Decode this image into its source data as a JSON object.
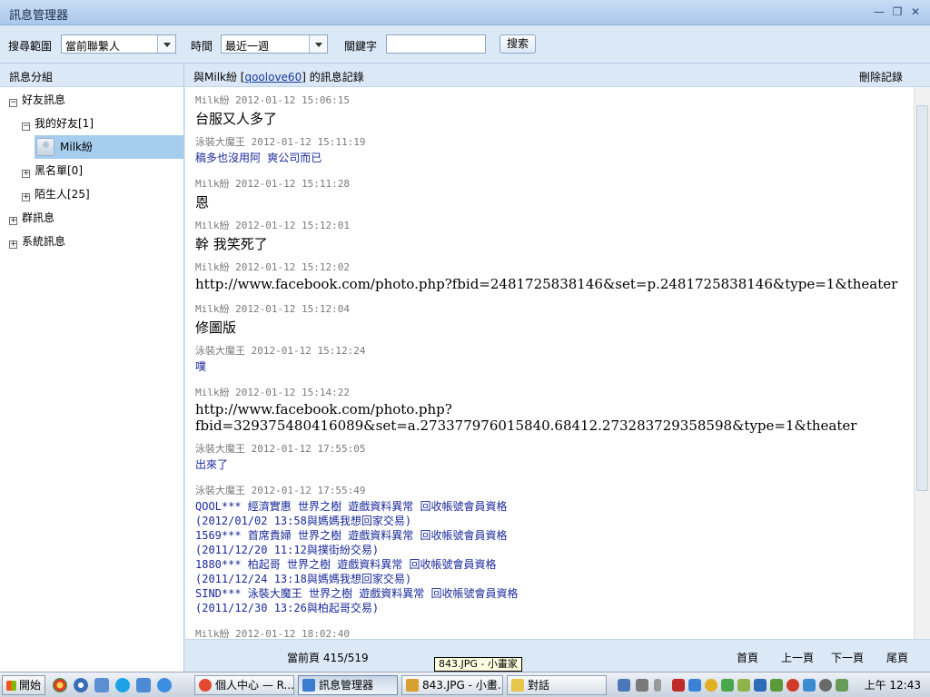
{
  "window": {
    "title": "訊息管理器",
    "minimize": "—",
    "restore": "❐",
    "close": "✕"
  },
  "search": {
    "scope_label": "搜尋範圍",
    "scope_value": "當前聯繫人",
    "time_label": "時間",
    "time_value": "最近一週",
    "keyword_label": "關鍵字",
    "keyword_value": "",
    "search_button": "搜索"
  },
  "sidebar": {
    "header": "訊息分組",
    "tree": [
      {
        "label": "好友訊息",
        "toggle": "−"
      },
      {
        "label": "我的好友[1]",
        "toggle": "−"
      },
      {
        "label": "Milk紛",
        "toggle": ""
      },
      {
        "label": "黑名單[0]",
        "toggle": "+"
      },
      {
        "label": "陌生人[25]",
        "toggle": "+"
      },
      {
        "label": "群訊息",
        "toggle": "+"
      },
      {
        "label": "系統訊息",
        "toggle": "+"
      }
    ]
  },
  "main": {
    "header_prefix": "與Milk紛 [",
    "header_link": "qoolove60",
    "header_suffix": "] 的訊息記錄",
    "delete_label": "刪除記錄"
  },
  "messages": [
    {
      "meta": "Milk紛 2012-01-12 15:06:15",
      "style": "big",
      "lines": [
        "台服又人多了"
      ]
    },
    {
      "meta": "泳裝大魔王 2012-01-12 15:11:19",
      "style": "blue",
      "lines": [
        "稿多也沒用阿 爽公司而已"
      ]
    },
    {
      "meta": "Milk紛 2012-01-12 15:11:28",
      "style": "big",
      "lines": [
        "恩"
      ]
    },
    {
      "meta": "Milk紛 2012-01-12 15:12:01",
      "style": "big",
      "lines": [
        "幹 我笑死了"
      ]
    },
    {
      "meta": "Milk紛 2012-01-12 15:12:02",
      "style": "big",
      "lines": [
        "http://www.facebook.com/photo.php?fbid=2481725838146&set=p.2481725838146&type=1&theater"
      ]
    },
    {
      "meta": "Milk紛 2012-01-12 15:12:04",
      "style": "big",
      "lines": [
        "修圖版"
      ]
    },
    {
      "meta": "泳裝大魔王 2012-01-12 15:12:24",
      "style": "blue",
      "lines": [
        "噗"
      ]
    },
    {
      "meta": "Milk紛 2012-01-12 15:14:22",
      "style": "big",
      "lines": [
        "http://www.facebook.com/photo.php?",
        "fbid=329375480416089&set=a.273377976015840.68412.273283729358598&type=1&theater"
      ]
    },
    {
      "meta": "泳裝大魔王 2012-01-12 17:55:05",
      "style": "blue",
      "lines": [
        "出來了"
      ]
    },
    {
      "meta": "泳裝大魔王 2012-01-12 17:55:49",
      "style": "blue",
      "lines": [
        "QOOL*** 經濟實惠 世界之樹 遊戲資料異常 回收帳號會員資格",
        "(2012/01/02 13:58與媽媽我想回家交易)",
        "1569*** 首席貴婦 世界之樹 遊戲資料異常 回收帳號會員資格",
        "(2011/12/20 11:12與撲街紛交易)",
        "1880*** 柏起哥 世界之樹 遊戲資料異常 回收帳號會員資格",
        "(2011/12/24 13:18與媽媽我想回家交易)",
        "SIND*** 泳裝大魔王 世界之樹 遊戲資料異常 回收帳號會員資格",
        "(2011/12/30 13:26與柏起哥交易)"
      ]
    },
    {
      "meta": "Milk紛 2012-01-12 18:02:40",
      "style": "big",
      "lines": []
    }
  ],
  "pager": {
    "current": "當前頁 415/519",
    "first": "首頁",
    "prev": "上一頁",
    "next": "下一頁",
    "last": "尾頁"
  },
  "tooltip": "843.JPG - 小畫家",
  "taskbar": {
    "start": "開始",
    "tasks": [
      {
        "label": "個人中心 — R...",
        "icon_color": "#e2492f"
      },
      {
        "label": "訊息管理器",
        "icon_color": "#3b7bd0"
      },
      {
        "label": "843.JPG - 小畫...",
        "icon_color": "#d8a030"
      },
      {
        "label": "對話",
        "icon_color": "#e8c64a"
      }
    ],
    "clock": "上午 12:43"
  }
}
